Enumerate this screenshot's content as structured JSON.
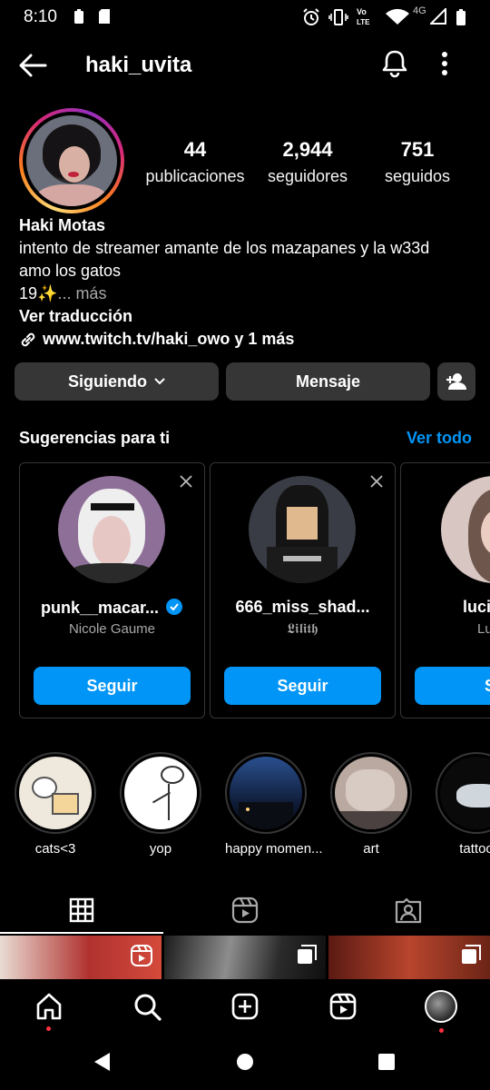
{
  "status": {
    "time": "8:10",
    "network": "4G"
  },
  "header": {
    "username": "haki_uvita"
  },
  "stats": [
    {
      "num": "44",
      "label": "publicaciones"
    },
    {
      "num": "2,944",
      "label": "seguidores"
    },
    {
      "num": "751",
      "label": "seguidos"
    }
  ],
  "bio": {
    "name": "Haki Motas",
    "line1": "intento de streamer amante de los mazapanes y la w33d",
    "line2": "amo los gatos",
    "line3": "19✨",
    "more": "... más",
    "translate": "Ver traducción",
    "link": "www.twitch.tv/haki_owo y 1 más"
  },
  "buttons": {
    "following": "Siguiendo",
    "message": "Mensaje"
  },
  "suggestions": {
    "title": "Sugerencias para ti",
    "see_all": "Ver todo",
    "cards": [
      {
        "username": "punk__macar...",
        "fullname": "Nicole Gaume",
        "verified": true,
        "button": "Seguir"
      },
      {
        "username": "666_miss_shad...",
        "fullname": "𝕷𝖎𝖑𝖎𝖙𝖍",
        "verified": false,
        "button": "Seguir"
      },
      {
        "username": "luci",
        "fullname": "Lu",
        "verified": false,
        "button": "Se"
      }
    ]
  },
  "highlights": [
    {
      "label": "cats<3"
    },
    {
      "label": "yop"
    },
    {
      "label": "happy momen..."
    },
    {
      "label": "art"
    },
    {
      "label": "tattoo"
    }
  ],
  "colors": {
    "accent": "#0095f6",
    "button_bg": "#363636",
    "badge": "#ff3040"
  }
}
